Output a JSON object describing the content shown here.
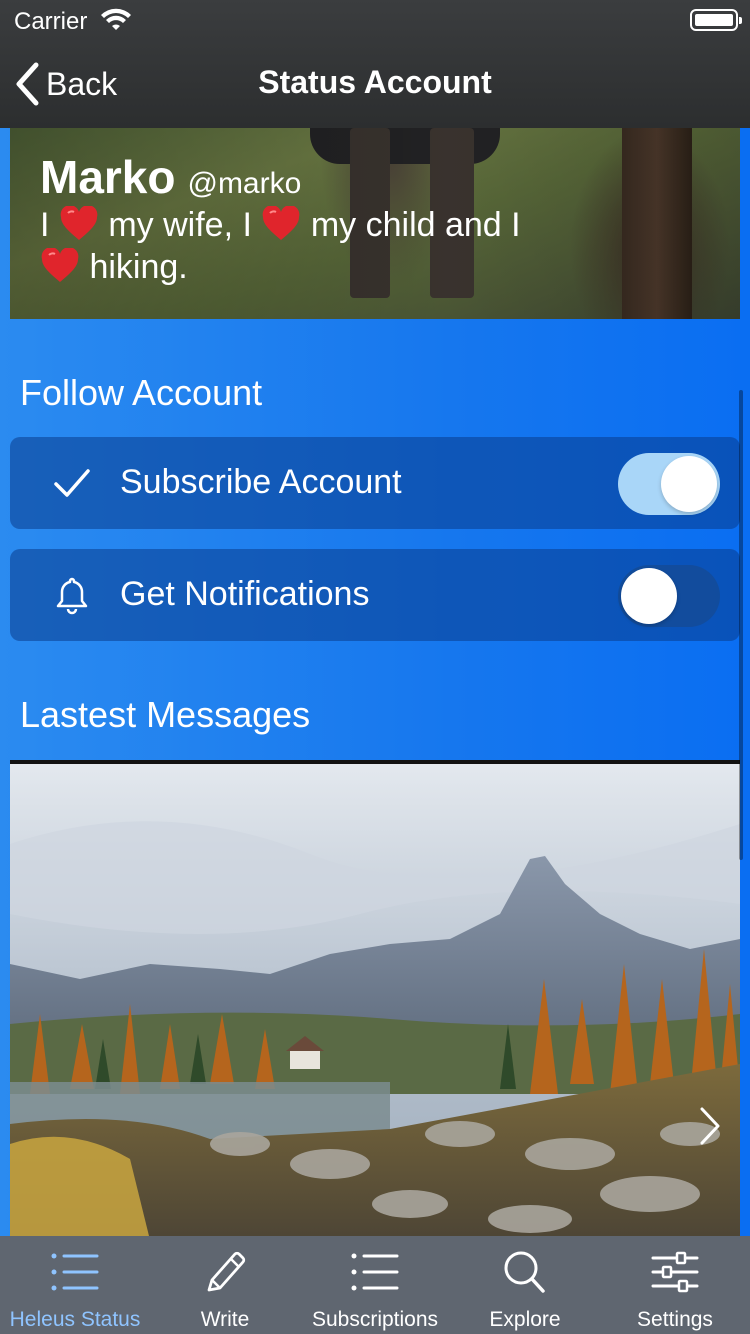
{
  "status_bar": {
    "carrier": "Carrier"
  },
  "nav": {
    "back_label": "Back",
    "title": "Status Account"
  },
  "profile": {
    "name": "Marko",
    "handle": "@marko",
    "bio_parts": [
      "I",
      "my wife, I",
      "my child and I",
      "hiking."
    ]
  },
  "follow": {
    "section_title": "Follow Account",
    "subscribe": {
      "label": "Subscribe Account",
      "enabled": true
    },
    "notifications": {
      "label": "Get Notifications",
      "enabled": false
    }
  },
  "messages": {
    "section_title": "Lastest Messages"
  },
  "tabs": [
    {
      "label": "Heleus Status",
      "icon": "list-icon",
      "active": true
    },
    {
      "label": "Write",
      "icon": "pencil-icon",
      "active": false
    },
    {
      "label": "Subscriptions",
      "icon": "list-icon",
      "active": false
    },
    {
      "label": "Explore",
      "icon": "search-icon",
      "active": false
    },
    {
      "label": "Settings",
      "icon": "sliders-icon",
      "active": false
    }
  ],
  "colors": {
    "accent_blue": "#1677ee",
    "active_tab": "#8fc4ff",
    "heart": "#e0252c",
    "switch_on": "#a9d6f8"
  }
}
